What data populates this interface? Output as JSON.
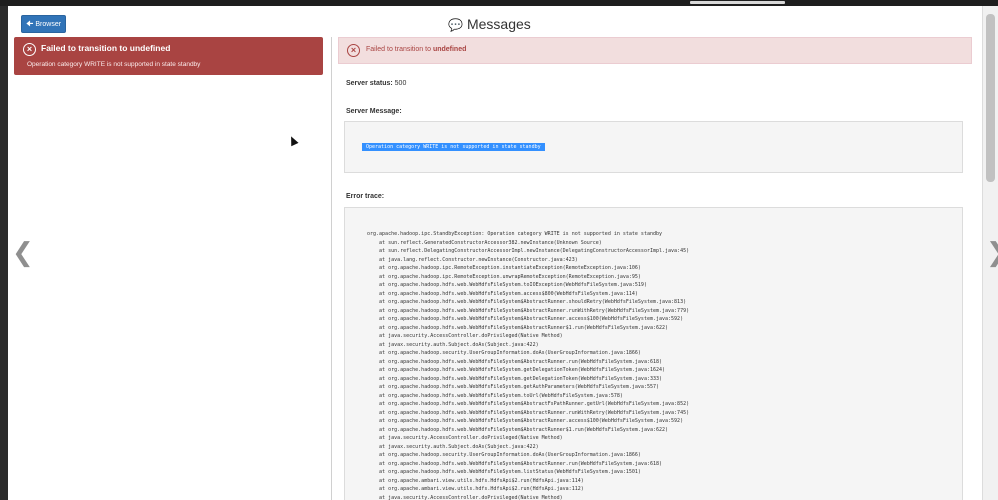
{
  "header": {
    "back_button_label": "Browser",
    "back_icon": "arrow-left-icon",
    "title_icon": "comment-icon",
    "title": "Messages"
  },
  "message_list": [
    {
      "icon": "x-circle-icon",
      "title_prefix": "Failed to transition to ",
      "title_value": "undefined",
      "subtitle": "Operation category WRITE is not supported in state standby"
    }
  ],
  "detail": {
    "alert_prefix": "Failed to transition to ",
    "alert_value": "undefined",
    "server_status_label": "Server status:",
    "server_status_value": "500",
    "server_message_label": "Server Message:",
    "server_message_text": "Operation category WRITE is not supported in state standby",
    "error_trace_label": "Error trace:",
    "error_trace_lines": [
      "org.apache.hadoop.ipc.StandbyException: Operation category WRITE is not supported in state standby",
      "    at sun.reflect.GeneratedConstructorAccessor382.newInstance(Unknown Source)",
      "    at sun.reflect.DelegatingConstructorAccessorImpl.newInstance(DelegatingConstructorAccessorImpl.java:45)",
      "    at java.lang.reflect.Constructor.newInstance(Constructor.java:423)",
      "    at org.apache.hadoop.ipc.RemoteException.instantiateException(RemoteException.java:106)",
      "    at org.apache.hadoop.ipc.RemoteException.unwrapRemoteException(RemoteException.java:95)",
      "    at org.apache.hadoop.hdfs.web.WebHdfsFileSystem.toIOException(WebHdfsFileSystem.java:519)",
      "    at org.apache.hadoop.hdfs.web.WebHdfsFileSystem.access$800(WebHdfsFileSystem.java:114)",
      "    at org.apache.hadoop.hdfs.web.WebHdfsFileSystem$AbstractRunner.shouldRetry(WebHdfsFileSystem.java:813)",
      "    at org.apache.hadoop.hdfs.web.WebHdfsFileSystem$AbstractRunner.runWithRetry(WebHdfsFileSystem.java:779)",
      "    at org.apache.hadoop.hdfs.web.WebHdfsFileSystem$AbstractRunner.access$100(WebHdfsFileSystem.java:592)",
      "    at org.apache.hadoop.hdfs.web.WebHdfsFileSystem$AbstractRunner$1.run(WebHdfsFileSystem.java:622)",
      "    at java.security.AccessController.doPrivileged(Native Method)",
      "    at javax.security.auth.Subject.doAs(Subject.java:422)",
      "    at org.apache.hadoop.security.UserGroupInformation.doAs(UserGroupInformation.java:1866)",
      "    at org.apache.hadoop.hdfs.web.WebHdfsFileSystem$AbstractRunner.run(WebHdfsFileSystem.java:618)",
      "    at org.apache.hadoop.hdfs.web.WebHdfsFileSystem.getDelegationToken(WebHdfsFileSystem.java:1624)",
      "    at org.apache.hadoop.hdfs.web.WebHdfsFileSystem.getDelegationToken(WebHdfsFileSystem.java:333)",
      "    at org.apache.hadoop.hdfs.web.WebHdfsFileSystem.getAuthParameters(WebHdfsFileSystem.java:557)",
      "    at org.apache.hadoop.hdfs.web.WebHdfsFileSystem.toUrl(WebHdfsFileSystem.java:578)",
      "    at org.apache.hadoop.hdfs.web.WebHdfsFileSystem$AbstractFsPathRunner.getUrl(WebHdfsFileSystem.java:852)",
      "    at org.apache.hadoop.hdfs.web.WebHdfsFileSystem$AbstractRunner.runWithRetry(WebHdfsFileSystem.java:745)",
      "    at org.apache.hadoop.hdfs.web.WebHdfsFileSystem$AbstractRunner.access$100(WebHdfsFileSystem.java:592)",
      "    at org.apache.hadoop.hdfs.web.WebHdfsFileSystem$AbstractRunner$1.run(WebHdfsFileSystem.java:622)",
      "    at java.security.AccessController.doPrivileged(Native Method)",
      "    at javax.security.auth.Subject.doAs(Subject.java:422)",
      "    at org.apache.hadoop.security.UserGroupInformation.doAs(UserGroupInformation.java:1866)",
      "    at org.apache.hadoop.hdfs.web.WebHdfsFileSystem$AbstractRunner.run(WebHdfsFileSystem.java:618)",
      "    at org.apache.hadoop.hdfs.web.WebHdfsFileSystem.listStatus(WebHdfsFileSystem.java:1501)",
      "    at org.apache.ambari.view.utils.hdfs.HdfsApi$2.run(HdfsApi.java:114)",
      "    at org.apache.ambari.view.utils.hdfs.HdfsApi$2.run(HdfsApi.java:112)",
      "    at java.security.AccessController.doPrivileged(Native Method)",
      "    at javax.security.auth.Subject.doAs(Subject.java:422)"
    ]
  },
  "colors": {
    "error_dark": "#a94442",
    "error_light": "#f2dede",
    "primary": "#3174b8",
    "selection": "#3390ff"
  },
  "nav": {
    "prev_icon": "chevron-left-icon",
    "next_icon": "chevron-right-icon"
  }
}
